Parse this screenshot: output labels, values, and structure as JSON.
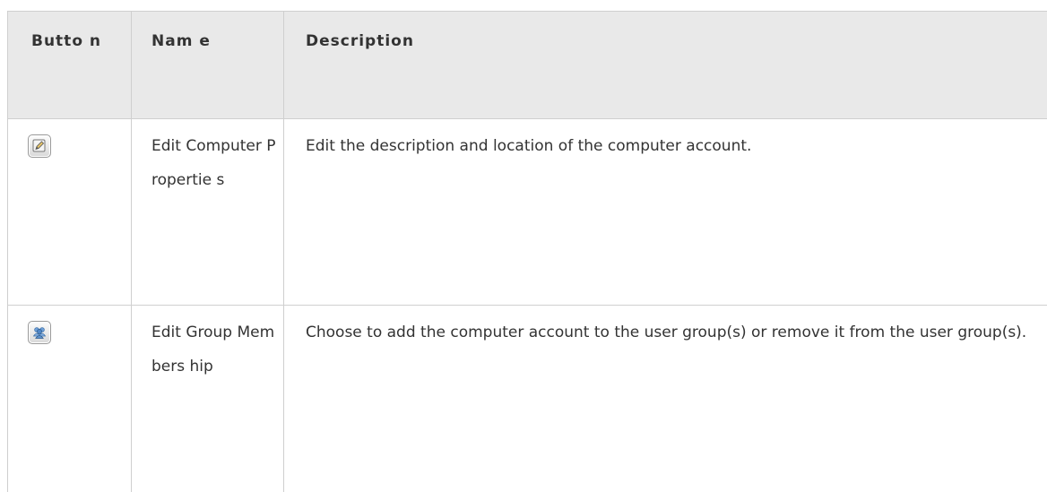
{
  "table": {
    "headers": {
      "button": "Butto n",
      "name": "Nam e",
      "description": "Description"
    },
    "rows": [
      {
        "icon": "edit-properties-icon",
        "name": "Edit Computer Propertie s",
        "description": "Edit the description and location of the computer account."
      },
      {
        "icon": "edit-group-membership-icon",
        "name": "Edit Group Members hip",
        "description": "Choose to add the computer account to the user group(s) or remove it from the user group(s)."
      }
    ]
  },
  "colors": {
    "header_bg": "#e9e9e9",
    "border": "#cfcfcf",
    "text": "#333333"
  }
}
